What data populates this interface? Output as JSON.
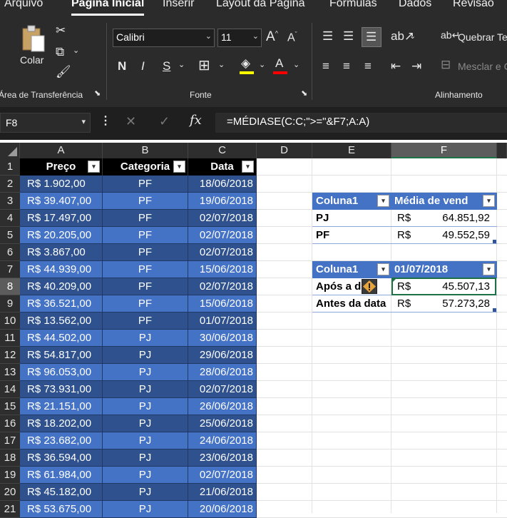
{
  "ribbon": {
    "tabs": [
      "Arquivo",
      "Página Inicial",
      "Inserir",
      "Layout da Página",
      "Fórmulas",
      "Dados",
      "Revisão"
    ],
    "active_tab": "Página Inicial",
    "clipboard": {
      "paste_label": "Colar",
      "group_label": "Área de Transferência"
    },
    "font": {
      "font_name": "Calibri",
      "font_size": "11",
      "bold": "N",
      "italic": "I",
      "underline": "S",
      "group_label": "Fonte",
      "fill_color": "#ffff00",
      "font_color": "#ff0000"
    },
    "alignment": {
      "wrap_text": "Quebrar Te",
      "merge": "Mesclar e C",
      "group_label": "Alinhamento"
    }
  },
  "formula_bar": {
    "name_box": "F8",
    "formula": "=MÉDIASE(C:C;\">=\"&F7;A:A)",
    "fx_label": "fx"
  },
  "columns": [
    "A",
    "B",
    "C",
    "D",
    "E",
    "F"
  ],
  "selected_column": "F",
  "selected_row": "8",
  "table1": {
    "headers": [
      "Preço",
      "Categoria",
      "Data"
    ],
    "rows": [
      [
        "R$   1.902,00",
        "PF",
        "18/06/2018"
      ],
      [
        "R$ 39.407,00",
        "PF",
        "19/06/2018"
      ],
      [
        "R$ 17.497,00",
        "PF",
        "02/07/2018"
      ],
      [
        "R$ 20.205,00",
        "PF",
        "02/07/2018"
      ],
      [
        "R$   3.867,00",
        "PF",
        "02/07/2018"
      ],
      [
        "R$ 44.939,00",
        "PF",
        "15/06/2018"
      ],
      [
        "R$ 40.209,00",
        "PF",
        "02/07/2018"
      ],
      [
        "R$ 36.521,00",
        "PF",
        "15/06/2018"
      ],
      [
        "R$ 13.562,00",
        "PF",
        "01/07/2018"
      ],
      [
        "R$ 44.502,00",
        "PJ",
        "30/06/2018"
      ],
      [
        "R$ 54.817,00",
        "PJ",
        "29/06/2018"
      ],
      [
        "R$ 96.053,00",
        "PJ",
        "28/06/2018"
      ],
      [
        "R$ 73.931,00",
        "PJ",
        "02/07/2018"
      ],
      [
        "R$ 21.151,00",
        "PJ",
        "26/06/2018"
      ],
      [
        "R$ 18.202,00",
        "PJ",
        "25/06/2018"
      ],
      [
        "R$ 23.682,00",
        "PJ",
        "24/06/2018"
      ],
      [
        "R$ 36.594,00",
        "PJ",
        "23/06/2018"
      ],
      [
        "R$ 61.984,00",
        "PJ",
        "02/07/2018"
      ],
      [
        "R$ 45.182,00",
        "PJ",
        "21/06/2018"
      ],
      [
        "R$ 53.675,00",
        "PJ",
        "20/06/2018"
      ]
    ]
  },
  "table2": {
    "headers": [
      "Coluna1",
      "Média de vend"
    ],
    "rows": [
      {
        "label": "PJ",
        "currency": "R$",
        "value": "64.851,92"
      },
      {
        "label": "PF",
        "currency": "R$",
        "value": "49.552,59"
      }
    ]
  },
  "table3": {
    "headers": [
      "Coluna1",
      "01/07/2018"
    ],
    "rows": [
      {
        "label": "Após a d",
        "currency": "R$",
        "value": "45.507,13"
      },
      {
        "label": "Antes da data",
        "currency": "R$",
        "value": "57.273,28"
      }
    ]
  },
  "row_numbers": [
    "1",
    "2",
    "3",
    "4",
    "5",
    "6",
    "7",
    "8",
    "9",
    "10",
    "11",
    "12",
    "13",
    "14",
    "15",
    "16",
    "17",
    "18",
    "19",
    "20",
    "21"
  ]
}
